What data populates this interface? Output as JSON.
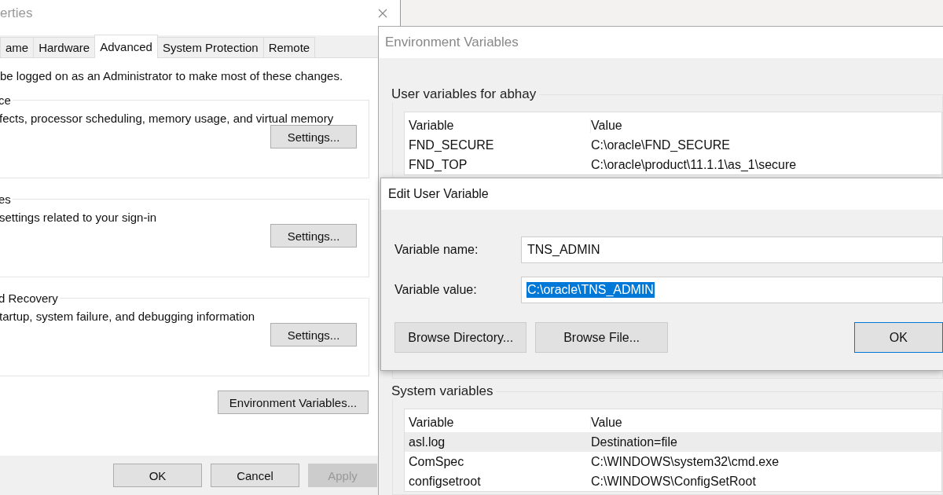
{
  "system_properties": {
    "title": "erties",
    "tabs": [
      {
        "label": "ame",
        "selected": false
      },
      {
        "label": "Hardware",
        "selected": false
      },
      {
        "label": "Advanced",
        "selected": true
      },
      {
        "label": "System Protection",
        "selected": false
      },
      {
        "label": "Remote",
        "selected": false
      }
    ],
    "notice": "be logged on as an Administrator to make most of these changes.",
    "groups": [
      {
        "title": "ce",
        "description": "fects, processor scheduling, memory usage, and virtual memory",
        "button": "Settings..."
      },
      {
        "title": "es",
        "description": "settings related to your sign-in",
        "button": "Settings..."
      },
      {
        "title": "d Recovery",
        "description": "tartup, system failure, and debugging information",
        "button": "Settings..."
      }
    ],
    "env_button": "Environment Variables...",
    "buttons": [
      {
        "label": "OK",
        "disabled": false
      },
      {
        "label": "Cancel",
        "disabled": false
      },
      {
        "label": "Apply",
        "disabled": true
      }
    ]
  },
  "environment_variables": {
    "title": "Environment Variables",
    "user_section": {
      "title": "User variables for abhay",
      "columns": [
        "Variable",
        "Value"
      ],
      "rows": [
        {
          "variable": "FND_SECURE",
          "value": "C:\\oracle\\FND_SECURE",
          "selected": false
        },
        {
          "variable": "FND_TOP",
          "value": "C:\\oracle\\product\\11.1.1\\as_1\\secure",
          "selected": false
        }
      ]
    },
    "system_section": {
      "title": "System variables",
      "columns": [
        "Variable",
        "Value"
      ],
      "rows": [
        {
          "variable": "asl.log",
          "value": "Destination=file",
          "selected": true
        },
        {
          "variable": "ComSpec",
          "value": "C:\\WINDOWS\\system32\\cmd.exe",
          "selected": false
        },
        {
          "variable": "configsetroot",
          "value": "C:\\WINDOWS\\ConfigSetRoot",
          "selected": false
        }
      ]
    }
  },
  "edit_dialog": {
    "title": "Edit User Variable",
    "fields": [
      {
        "label": "Variable name:",
        "value": "TNS_ADMIN",
        "selected": false
      },
      {
        "label": "Variable value:",
        "value": "C:\\oracle\\TNS_ADMIN",
        "selected": true
      }
    ],
    "buttons": [
      {
        "label": "Browse Directory...",
        "focused": false
      },
      {
        "label": "Browse File...",
        "focused": false
      },
      {
        "label": "OK",
        "focused": true
      }
    ]
  }
}
